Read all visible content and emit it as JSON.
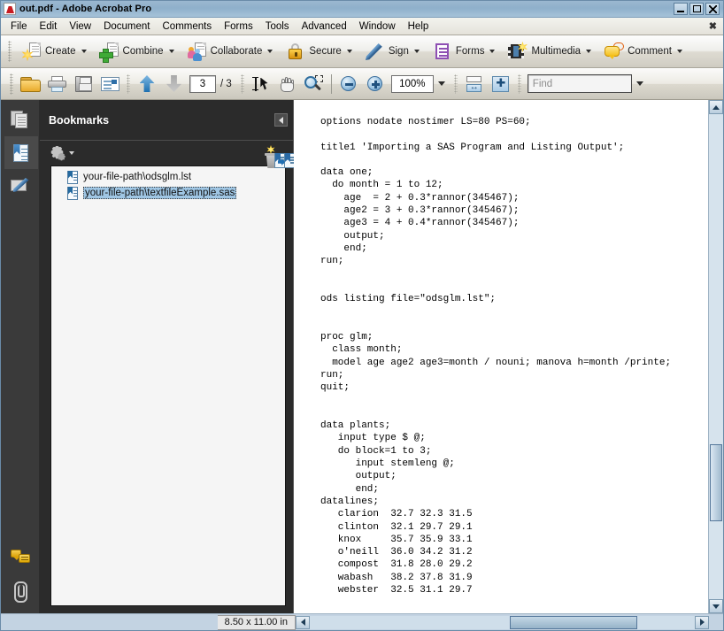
{
  "window": {
    "title": "out.pdf - Adobe Acrobat Pro",
    "app_icon": "pdf-document-icon",
    "minimize_label": "Minimize",
    "maximize_label": "Maximize",
    "close_label": "Close"
  },
  "menubar": {
    "items": [
      {
        "label": "File"
      },
      {
        "label": "Edit"
      },
      {
        "label": "View"
      },
      {
        "label": "Document"
      },
      {
        "label": "Comments"
      },
      {
        "label": "Forms"
      },
      {
        "label": "Tools"
      },
      {
        "label": "Advanced"
      },
      {
        "label": "Window"
      },
      {
        "label": "Help"
      }
    ],
    "close_document_label": "✖"
  },
  "toolbar_main": {
    "buttons": [
      {
        "label": "Create",
        "icon": "create-pdf-icon",
        "has_dropdown": true
      },
      {
        "label": "Combine",
        "icon": "combine-files-icon",
        "has_dropdown": true
      },
      {
        "label": "Collaborate",
        "icon": "collaborate-icon",
        "has_dropdown": true
      },
      {
        "label": "Secure",
        "icon": "padlock-icon",
        "has_dropdown": true
      },
      {
        "label": "Sign",
        "icon": "pen-icon",
        "has_dropdown": true
      },
      {
        "label": "Forms",
        "icon": "forms-icon",
        "has_dropdown": true
      },
      {
        "label": "Multimedia",
        "icon": "multimedia-film-icon",
        "has_dropdown": true
      },
      {
        "label": "Comment",
        "icon": "comment-bubble-icon",
        "has_dropdown": true
      }
    ]
  },
  "toolbar_nav": {
    "open_label": "Open",
    "print_label": "Print",
    "save_label": "Save",
    "email_label": "Email",
    "previous_page_label": "Previous Page",
    "next_page_label": "Next Page",
    "page_number": "3",
    "page_total": "/ 3",
    "select_tool_label": "Select Tool",
    "hand_tool_label": "Hand Tool",
    "marquee_zoom_label": "Marquee Zoom",
    "zoom_out_label": "Zoom Out",
    "zoom_in_label": "Zoom In",
    "zoom_level": "100%",
    "fit_width_label": "Fit Width",
    "fit_page_label": "Fit Page",
    "find_placeholder": "Find",
    "find_value": ""
  },
  "navigation_rail": {
    "items": [
      {
        "icon": "pages-thumbnails-icon",
        "label": "Page Thumbnails",
        "active": false
      },
      {
        "icon": "bookmarks-icon",
        "label": "Bookmarks",
        "active": true
      },
      {
        "icon": "signatures-icon",
        "label": "Signatures",
        "active": false
      }
    ],
    "bottom_items": [
      {
        "icon": "comments-icon",
        "label": "Comments"
      },
      {
        "icon": "paperclip-icon",
        "label": "Attachments"
      }
    ]
  },
  "bookmarks_panel": {
    "title": "Bookmarks",
    "collapse_label": "Collapse panel",
    "options_icon": "gear-icon",
    "options_label": "Options",
    "delete_label": "Delete",
    "new_bookmark_label": "New Bookmark",
    "expand_bookmark_label": "Expand Current Bookmark",
    "items": [
      {
        "label": "your-file-path\\odsglm.lst",
        "selected": false
      },
      {
        "label": "your-file-path\\textfileExample.sas",
        "selected": true
      }
    ]
  },
  "document": {
    "content": "options nodate nostimer LS=80 PS=60;\n\ntitle1 'Importing a SAS Program and Listing Output';\n\ndata one;\n  do month = 1 to 12;\n    age  = 2 + 0.3*rannor(345467);\n    age2 = 3 + 0.3*rannor(345467);\n    age3 = 4 + 0.4*rannor(345467);\n    output;\n    end;\nrun;\n\n\nods listing file=\"odsglm.lst\";\n\n\nproc glm;\n  class month;\n  model age age2 age3=month / nouni; manova h=month /printe;\nrun;\nquit;\n\n\ndata plants;\n   input type $ @;\n   do block=1 to 3;\n      input stemleng @;\n      output;\n      end;\ndatalines;\n   clarion  32.7 32.3 31.5\n   clinton  32.1 29.7 29.1\n   knox     35.7 35.9 33.1\n   o'neill  36.0 34.2 31.2\n   compost  31.8 28.0 29.2\n   wabash   38.2 37.8 31.9\n   webster  32.5 31.1 29.7"
  },
  "scrollbars": {
    "vertical_up_label": "Scroll Up",
    "vertical_down_label": "Scroll Down",
    "horizontal_left_label": "Scroll Left",
    "horizontal_right_label": "Scroll Right"
  },
  "statusbar": {
    "page_size": "8.50 x 11.00 in"
  }
}
